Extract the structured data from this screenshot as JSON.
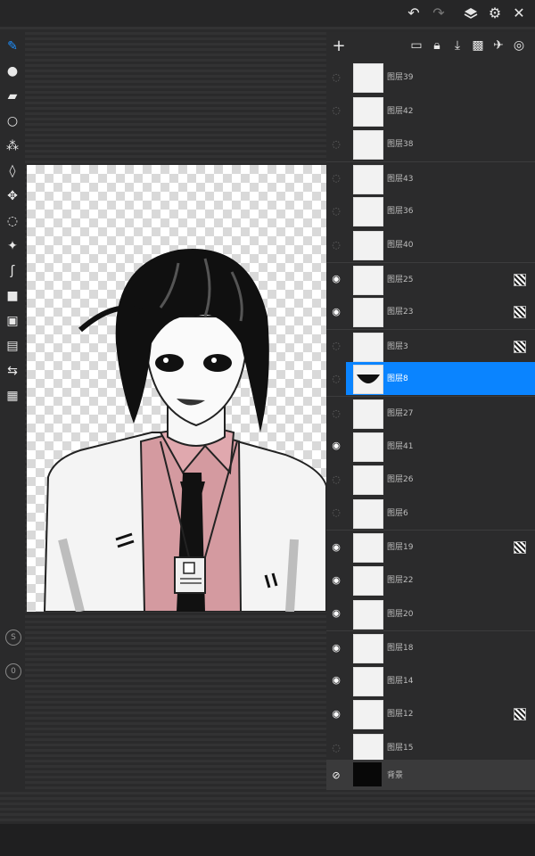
{
  "toolbar_top": {
    "icons": [
      "undo-icon",
      "redo-icon",
      "layers-icon",
      "gear-icon",
      "close-icon"
    ]
  },
  "tools": [
    {
      "name": "pen-tool-icon",
      "active": true
    },
    {
      "name": "brush-icon"
    },
    {
      "name": "eraser-icon"
    },
    {
      "name": "ellipse-icon"
    },
    {
      "name": "blur-icon"
    },
    {
      "name": "lasso-icon"
    },
    {
      "name": "move-icon"
    },
    {
      "name": "selection-icon"
    },
    {
      "name": "magic-wand-icon"
    },
    {
      "name": "curve-icon"
    },
    {
      "name": "camera-icon"
    },
    {
      "name": "image-icon"
    },
    {
      "name": "adjust-icon"
    },
    {
      "name": "transform-icon"
    },
    {
      "name": "grid-icon"
    }
  ],
  "layers_panel": {
    "header_icons": [
      "add-icon",
      "folder-icon",
      "lock-icon",
      "merge-down-icon",
      "checker-icon",
      "pin-icon",
      "target-icon"
    ],
    "layers": [
      {
        "name": "图层39",
        "visible": false,
        "clip": false
      },
      {
        "name": "图层42",
        "visible": false,
        "clip": false
      },
      {
        "name": "图层38",
        "visible": false,
        "clip": false
      },
      {
        "name": "图层43",
        "visible": false,
        "clip": false
      },
      {
        "name": "图层36",
        "visible": false,
        "clip": false
      },
      {
        "name": "图层40",
        "visible": false,
        "clip": false
      },
      {
        "name": "图层25",
        "visible": true,
        "clip": true
      },
      {
        "name": "图层23",
        "visible": true,
        "clip": true
      },
      {
        "name": "图层3",
        "visible": false,
        "clip": true
      },
      {
        "name": "图层8",
        "visible": false,
        "clip": false,
        "selected": true
      },
      {
        "name": "图层27",
        "visible": false,
        "clip": false
      },
      {
        "name": "图层41",
        "visible": true,
        "clip": false
      },
      {
        "name": "图层26",
        "visible": false,
        "clip": false
      },
      {
        "name": "图层6",
        "visible": false,
        "clip": false
      },
      {
        "name": "图层19",
        "visible": true,
        "clip": true
      },
      {
        "name": "图层22",
        "visible": true,
        "clip": false
      },
      {
        "name": "图层20",
        "visible": true,
        "clip": false
      },
      {
        "name": "图层18",
        "visible": true,
        "clip": false
      },
      {
        "name": "图层14",
        "visible": true,
        "clip": false
      },
      {
        "name": "图层12",
        "visible": true,
        "clip": true
      },
      {
        "name": "图层15",
        "visible": false,
        "clip": false
      }
    ],
    "background": {
      "name": "背景",
      "visible": false
    }
  },
  "colors": {
    "accent": "#0a84ff",
    "tie": "#111111",
    "shirt": "#d49aa0",
    "hair": "#101010"
  }
}
